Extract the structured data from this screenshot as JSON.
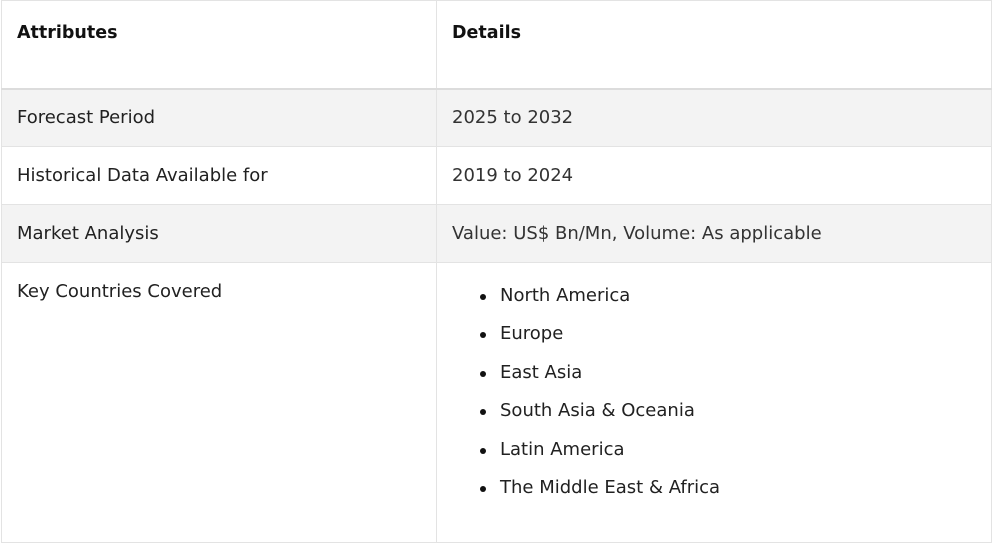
{
  "table": {
    "headers": [
      "Attributes",
      "Details"
    ],
    "rows": [
      {
        "attribute": "Forecast Period",
        "detail": "2025 to 2032"
      },
      {
        "attribute": "Historical Data Available for",
        "detail": "2019 to 2024"
      },
      {
        "attribute": "Market Analysis",
        "detail": "Value: US$ Bn/Mn, Volume: As applicable"
      },
      {
        "attribute": "Key Countries Covered",
        "detail_list": [
          "North America",
          "Europe",
          "East Asia",
          "South Asia & Oceania",
          "Latin America",
          "The Middle East & Africa"
        ]
      }
    ]
  }
}
